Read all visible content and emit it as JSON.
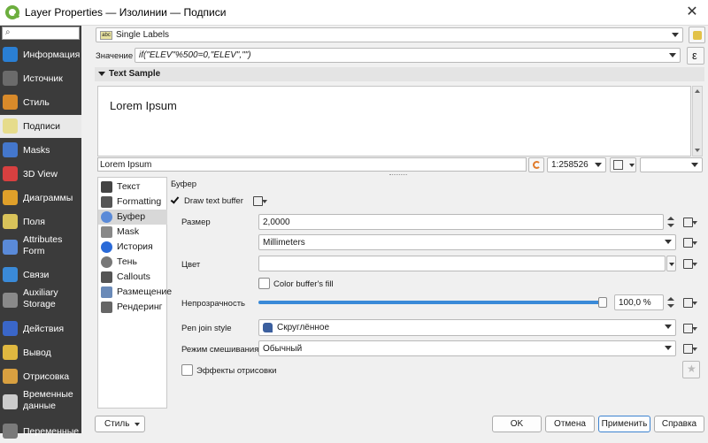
{
  "window": {
    "title": "Layer Properties — Изолинии — Подписи",
    "close": "✕"
  },
  "sidebar": {
    "search_icon": "⌕",
    "items": [
      {
        "label": "Информация",
        "icon": "info-icon"
      },
      {
        "label": "Источник",
        "icon": "source-icon"
      },
      {
        "label": "Стиль",
        "icon": "brush-icon"
      },
      {
        "label": "Подписи",
        "icon": "labels-icon"
      },
      {
        "label": "Masks",
        "icon": "masks-icon"
      },
      {
        "label": "3D View",
        "icon": "cube-icon"
      },
      {
        "label": "Диаграммы",
        "icon": "diagram-icon"
      },
      {
        "label": "Поля",
        "icon": "fields-icon"
      },
      {
        "label": "Attributes Form",
        "icon": "form-icon"
      },
      {
        "label": "Связи",
        "icon": "joins-icon"
      },
      {
        "label": "Auxiliary Storage",
        "icon": "storage-icon"
      },
      {
        "label": "Действия",
        "icon": "actions-icon"
      },
      {
        "label": "Вывод",
        "icon": "display-icon"
      },
      {
        "label": "Отрисовка",
        "icon": "rendering-icon"
      },
      {
        "label": "Временные данные",
        "icon": "temporal-icon"
      },
      {
        "label": "Переменные",
        "icon": "variables-icon"
      }
    ]
  },
  "mode": {
    "icon_text": "abc",
    "value": "Single Labels"
  },
  "value_row": {
    "label": "Значение",
    "expression": "if(\"ELEV\"%500=0,\"ELEV\",\"\")",
    "expr_button": "ε"
  },
  "text_sample": {
    "header": "Text Sample",
    "preview": "Lorem Ipsum",
    "input": "Lorem Ipsum",
    "scale": "1:258526"
  },
  "tabs": [
    {
      "label": "Текст",
      "icon": "text-icon"
    },
    {
      "label": "Formatting",
      "icon": "formatting-icon"
    },
    {
      "label": "Буфер",
      "icon": "buffer-icon"
    },
    {
      "label": "Mask",
      "icon": "mask-icon"
    },
    {
      "label": "История",
      "icon": "background-icon"
    },
    {
      "label": "Тень",
      "icon": "shadow-icon"
    },
    {
      "label": "Callouts",
      "icon": "callouts-icon"
    },
    {
      "label": "Размещение",
      "icon": "placement-icon"
    },
    {
      "label": "Рендеринг",
      "icon": "rendering-icon"
    }
  ],
  "buffer": {
    "section_title": "Буфер",
    "draw_buffer_label": "Draw text buffer",
    "draw_buffer_checked": true,
    "size_label": "Размер",
    "size_value": "2,0000",
    "unit_value": "Millimeters",
    "color_label": "Цвет",
    "color_fill_label": "Color buffer's fill",
    "opacity_label": "Непрозрачность",
    "opacity_value": "100,0 %",
    "opacity_fraction": 1.0,
    "pen_join_label": "Pen join style",
    "pen_join_value": "Скруглённое",
    "blend_label": "Режим смешивания",
    "blend_value": "Обычный",
    "effects_label": "Эффекты отрисовки",
    "accent": "#3a8ad8"
  },
  "footer": {
    "style": "Стиль",
    "ok": "OK",
    "cancel": "Отмена",
    "apply": "Применить",
    "help": "Справка"
  }
}
